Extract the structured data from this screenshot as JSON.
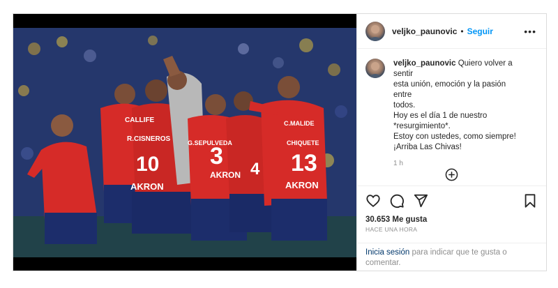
{
  "post": {
    "username": "veljko_paunovic",
    "separator": "•",
    "follow_label": "Seguir",
    "more_label": "•••",
    "caption": {
      "username": "veljko_paunovic",
      "lines": [
        "Quiero volver a sentir",
        "esta unión, emoción y la pasión entre",
        "todos.",
        "Hoy es el día 1 de nuestro",
        "*resurgimiento*.",
        "Estoy con ustedes, como siempre!",
        "",
        "¡Arriba Las Chivas!"
      ],
      "time": "1 h"
    },
    "likes": "30.653 Me gusta",
    "time_ago": "HACE UNA HORA",
    "login_link": "Inicia sesión",
    "login_text": "para indicar que te gusta o",
    "login_text2": "comentar."
  },
  "photo": {
    "jersey_texts": [
      "CALLIFE",
      "R.CISNEROS",
      "G.SEPULVEDA",
      "C.MALIDE",
      "CHIQUETE",
      "AKRON"
    ],
    "jersey_numbers": [
      "10",
      "3",
      "13",
      "4"
    ]
  },
  "icons": [
    "heart-icon",
    "comment-icon",
    "share-icon",
    "bookmark-icon",
    "add-comment-icon",
    "more-icon"
  ],
  "colors": {
    "follow": "#0095f6",
    "link": "#00376b",
    "jersey": "#d62b28",
    "shorts": "#1c2d6b"
  }
}
